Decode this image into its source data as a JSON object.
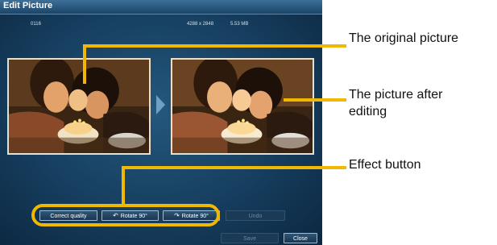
{
  "window": {
    "title": "Edit Picture",
    "file_name": "0116",
    "dimensions": "4288 x 2848",
    "file_size": "5.53 MB"
  },
  "buttons": {
    "correct_quality": "Correct quality",
    "rotate_left": "Rotate 90°",
    "rotate_right": "Rotate 90°",
    "undo": "Undo",
    "save": "Save",
    "close": "Close"
  },
  "icons": {
    "rotate_left": "rotate-left-icon",
    "rotate_right": "rotate-right-icon",
    "next_arrow": "arrow-right-icon"
  },
  "callouts": {
    "original": "The original picture",
    "after_line1": "The picture after",
    "after_line2": "editing",
    "effect": "Effect button"
  },
  "colors": {
    "callout": "#f0b800",
    "window_bg": "#163e5f"
  }
}
